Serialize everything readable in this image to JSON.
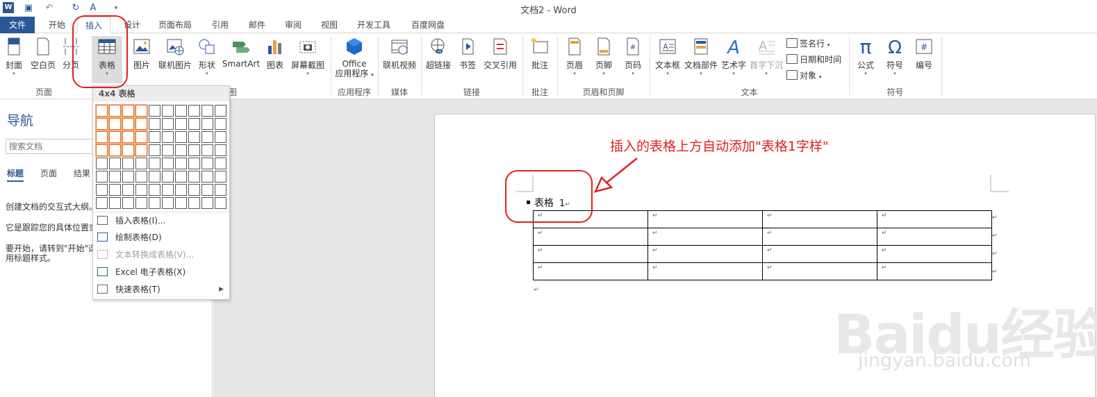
{
  "window": {
    "title": "文档2 - Word"
  },
  "tabs": [
    "文件",
    "开始",
    "插入",
    "设计",
    "页面布局",
    "引用",
    "邮件",
    "审阅",
    "视图",
    "开发工具",
    "百度网盘"
  ],
  "active_tab": "插入",
  "ribbon": {
    "buttons": [
      {
        "label": "封面",
        "icon": "cover-page-icon"
      },
      {
        "label": "空白页",
        "icon": "blank-page-icon"
      },
      {
        "label": "分页",
        "icon": "page-break-icon"
      },
      {
        "label": "表格",
        "icon": "table-icon"
      },
      {
        "label": "图片",
        "icon": "picture-icon"
      },
      {
        "label": "联机图片",
        "icon": "online-picture-icon"
      },
      {
        "label": "形状",
        "icon": "shapes-icon"
      },
      {
        "label": "SmartArt",
        "icon": "smartart-icon"
      },
      {
        "label": "图表",
        "icon": "chart-icon"
      },
      {
        "label": "屏幕截图",
        "icon": "screenshot-icon"
      },
      {
        "label": "Office\n应用程序",
        "icon": "office-apps-icon"
      },
      {
        "label": "联机视频",
        "icon": "online-video-icon"
      },
      {
        "label": "超链接",
        "icon": "hyperlink-icon"
      },
      {
        "label": "书签",
        "icon": "bookmark-icon"
      },
      {
        "label": "交叉引用",
        "icon": "cross-reference-icon"
      },
      {
        "label": "批注",
        "icon": "comment-icon"
      },
      {
        "label": "页眉",
        "icon": "header-icon"
      },
      {
        "label": "页脚",
        "icon": "footer-icon"
      },
      {
        "label": "页码",
        "icon": "page-number-icon"
      },
      {
        "label": "文本框",
        "icon": "text-box-icon"
      },
      {
        "label": "文档部件",
        "icon": "quick-parts-icon"
      },
      {
        "label": "艺术字",
        "icon": "wordart-icon"
      },
      {
        "label": "首字下沉",
        "icon": "drop-cap-icon"
      },
      {
        "label": "公式",
        "icon": "equation-icon"
      },
      {
        "label": "符号",
        "icon": "symbol-icon"
      },
      {
        "label": "编号",
        "icon": "number-icon"
      }
    ],
    "small_buttons": [
      {
        "label": "签名行",
        "icon": "signature-line-icon"
      },
      {
        "label": "日期和时间",
        "icon": "date-time-icon"
      },
      {
        "label": "对象",
        "icon": "object-icon"
      }
    ],
    "groups": [
      "页面",
      "图",
      "应用程序",
      "媒体",
      "链接",
      "批注",
      "页眉和页脚",
      "文本",
      "符号"
    ]
  },
  "nav_pane": {
    "title": "导航",
    "search_placeholder": "搜索文档",
    "tabs": [
      "标题",
      "页面",
      "结果"
    ],
    "text1": "创建文档的交互式大纲。",
    "text2": "它是跟踪您的具体位置或",
    "text3": "要开始，请转到\"开始\"选",
    "text4": "用标题样式。"
  },
  "table_dropdown": {
    "header": "4x4 表格",
    "grid": {
      "cols": 10,
      "rows": 8,
      "selected_cols": 4,
      "selected_rows": 4
    },
    "items": [
      {
        "label": "插入表格(I)...",
        "enabled": true,
        "icon": "insert-table-icon"
      },
      {
        "label": "绘制表格(D)",
        "enabled": true,
        "icon": "draw-table-icon"
      },
      {
        "label": "文本转换成表格(V)...",
        "enabled": false,
        "icon": "convert-text-icon"
      },
      {
        "label": "Excel 电子表格(X)",
        "enabled": true,
        "icon": "excel-icon"
      },
      {
        "label": "快速表格(T)",
        "enabled": true,
        "icon": "quick-tables-icon",
        "submenu": true
      }
    ]
  },
  "document": {
    "caption_label": "表格",
    "caption_number": "1",
    "para_mark": "↵",
    "table": {
      "rows": 4,
      "cols": 4
    }
  },
  "annotation": {
    "text": "插入的表格上方自动添加\"表格1字样\""
  },
  "watermark": {
    "main": "Baidu经验",
    "sub": "jingyan.baidu.com"
  },
  "colors": {
    "accent": "#2b579a",
    "annotation_red": "#e02020",
    "grid_highlight": "#e8701d"
  }
}
